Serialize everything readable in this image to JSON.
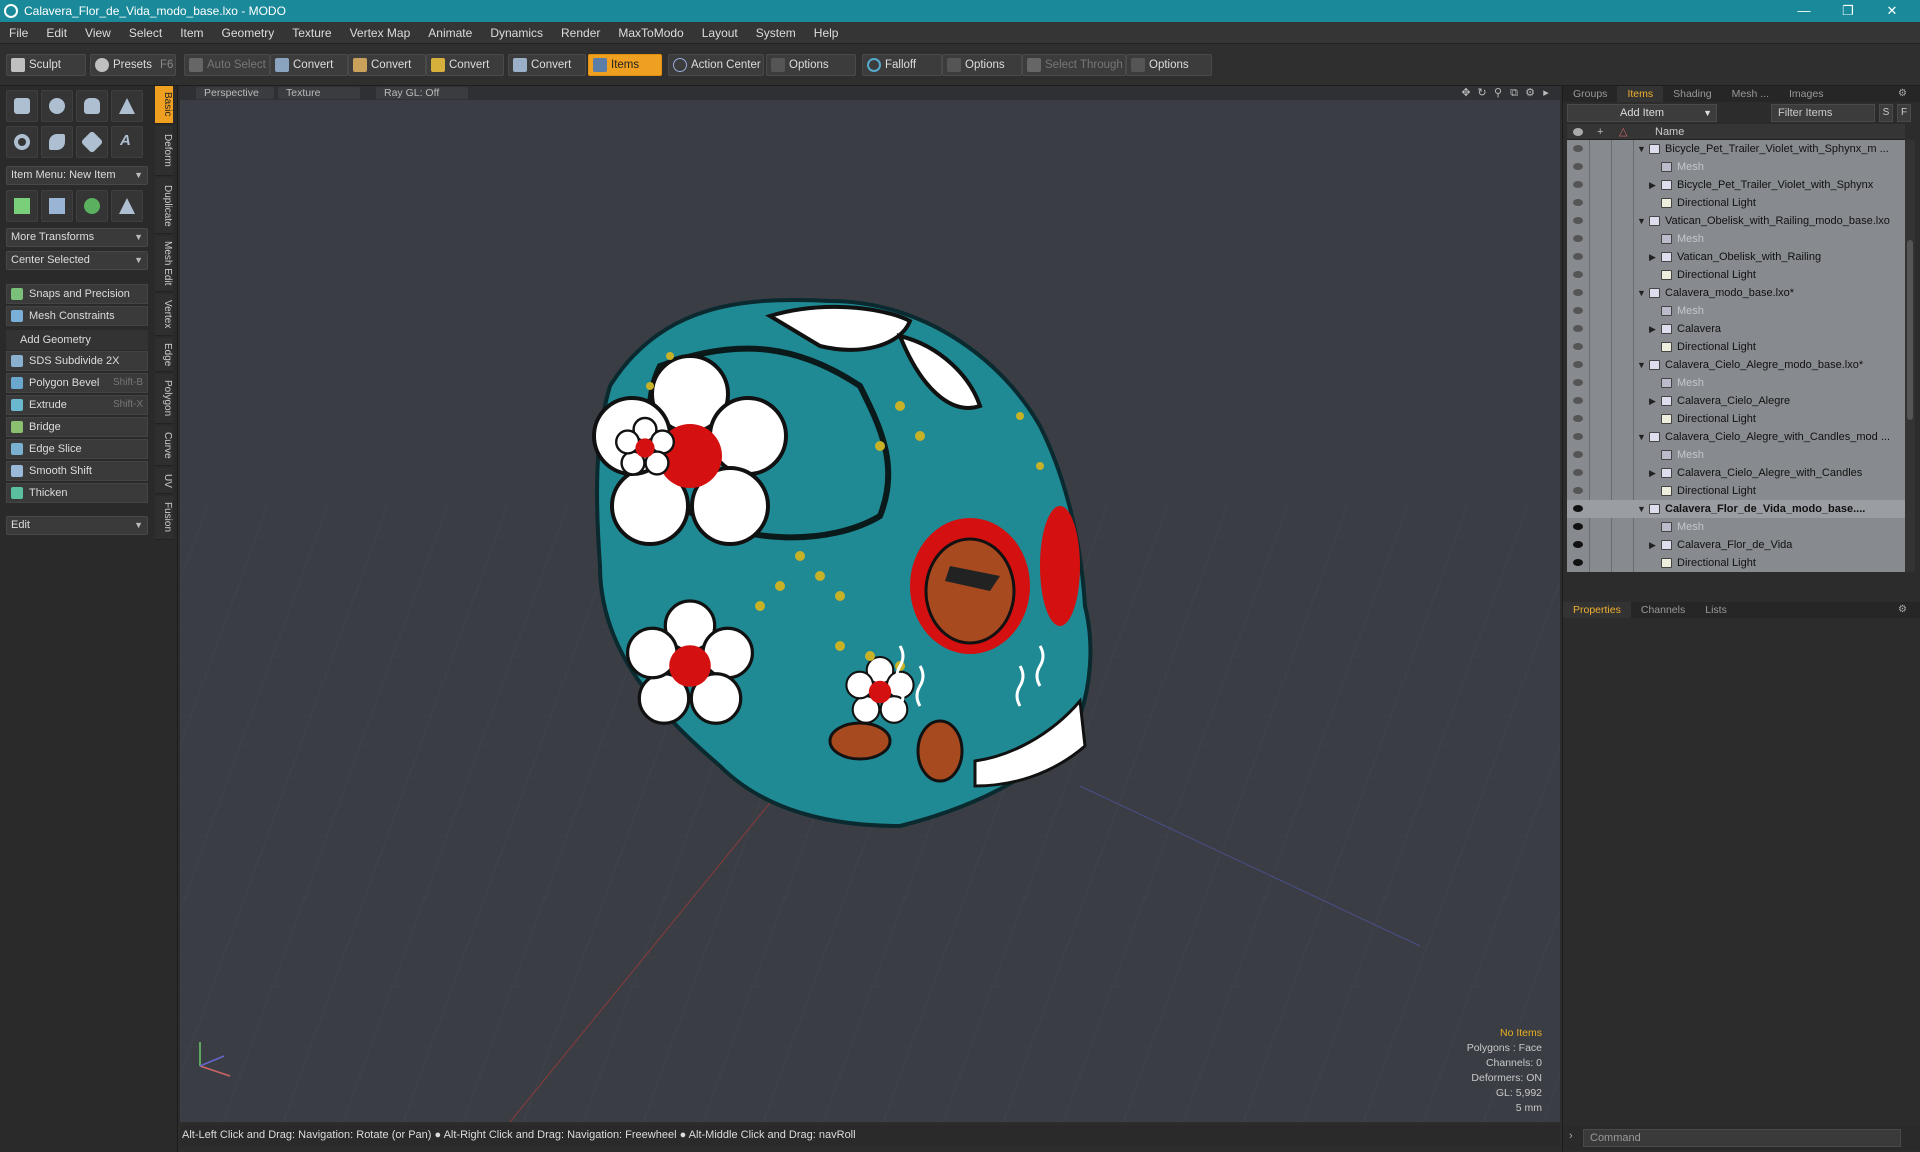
{
  "window": {
    "title": "Calavera_Flor_de_Vida_modo_base.lxo - MODO"
  },
  "menu": [
    "File",
    "Edit",
    "View",
    "Select",
    "Item",
    "Geometry",
    "Texture",
    "Vertex Map",
    "Animate",
    "Dynamics",
    "Render",
    "MaxToModo",
    "Layout",
    "System",
    "Help"
  ],
  "toolbar": {
    "sculpt": "Sculpt",
    "presets": "Presets",
    "presets_key": "F6",
    "auto_select": "Auto Select",
    "convert1": "Convert",
    "convert2": "Convert",
    "convert3": "Convert",
    "convert4": "Convert",
    "items": "Items",
    "action_center": "Action Center",
    "options1": "Options",
    "falloff": "Falloff",
    "options2": "Options",
    "select_through": "Select Through",
    "options3": "Options"
  },
  "left": {
    "item_menu": "Item Menu: New Item",
    "more_transforms": "More Transforms",
    "center_selected": "Center Selected",
    "snaps": "Snaps and Precision",
    "mesh_constraints": "Mesh Constraints",
    "add_geometry": "Add Geometry",
    "tools": [
      {
        "label": "SDS Subdivide 2X",
        "key": ""
      },
      {
        "label": "Polygon Bevel",
        "key": "Shift-B"
      },
      {
        "label": "Extrude",
        "key": "Shift-X"
      },
      {
        "label": "Bridge",
        "key": ""
      },
      {
        "label": "Edge Slice",
        "key": ""
      },
      {
        "label": "Smooth Shift",
        "key": ""
      },
      {
        "label": "Thicken",
        "key": ""
      }
    ],
    "edit": "Edit",
    "vtabs": [
      "Basic",
      "Deform",
      "Duplicate",
      "Mesh Edit",
      "Vertex",
      "Edge",
      "Polygon",
      "Curve",
      "UV",
      "Fusion"
    ]
  },
  "viewport": {
    "perspective": "Perspective",
    "texture": "Texture",
    "raygl": "Ray GL: Off",
    "hud": {
      "no_items": "No Items",
      "polygons": "Polygons : Face",
      "channels": "Channels: 0",
      "deformers": "Deformers: ON",
      "gl": "GL: 5,992",
      "unit": "5 mm"
    }
  },
  "status": "Alt-Left Click and Drag: Navigation: Rotate (or Pan) ● Alt-Right Click and Drag: Navigation: Freewheel ● Alt-Middle Click and Drag: navRoll",
  "right": {
    "tabs": [
      "Groups",
      "Items",
      "Shading",
      "Mesh ...",
      "Images"
    ],
    "add_item": "Add Item",
    "filter": "Filter Items",
    "s": "S",
    "f": "F",
    "name_col": "Name",
    "rows": [
      {
        "label": "Bicycle_Pet_Trailer_Violet_with_Sphynx_m ...",
        "level": 0,
        "type": "scene"
      },
      {
        "label": "Mesh",
        "level": 1,
        "type": "mesh"
      },
      {
        "label": "Bicycle_Pet_Trailer_Violet_with_Sphynx",
        "level": 1,
        "type": "item"
      },
      {
        "label": "Directional Light",
        "level": 1,
        "type": "light"
      },
      {
        "label": "Vatican_Obelisk_with_Railing_modo_base.lxo",
        "level": 0,
        "type": "scene"
      },
      {
        "label": "Mesh",
        "level": 1,
        "type": "mesh"
      },
      {
        "label": "Vatican_Obelisk_with_Railing",
        "level": 1,
        "type": "item"
      },
      {
        "label": "Directional Light",
        "level": 1,
        "type": "light"
      },
      {
        "label": "Calavera_modo_base.lxo*",
        "level": 0,
        "type": "scene"
      },
      {
        "label": "Mesh",
        "level": 1,
        "type": "mesh"
      },
      {
        "label": "Calavera",
        "level": 1,
        "type": "item"
      },
      {
        "label": "Directional Light",
        "level": 1,
        "type": "light"
      },
      {
        "label": "Calavera_Cielo_Alegre_modo_base.lxo*",
        "level": 0,
        "type": "scene"
      },
      {
        "label": "Mesh",
        "level": 1,
        "type": "mesh"
      },
      {
        "label": "Calavera_Cielo_Alegre",
        "level": 1,
        "type": "item"
      },
      {
        "label": "Directional Light",
        "level": 1,
        "type": "light"
      },
      {
        "label": "Calavera_Cielo_Alegre_with_Candles_mod ...",
        "level": 0,
        "type": "scene"
      },
      {
        "label": "Mesh",
        "level": 1,
        "type": "mesh"
      },
      {
        "label": "Calavera_Cielo_Alegre_with_Candles",
        "level": 1,
        "type": "item"
      },
      {
        "label": "Directional Light",
        "level": 1,
        "type": "light"
      },
      {
        "label": "Calavera_Flor_de_Vida_modo_base....",
        "level": 0,
        "type": "scene",
        "bold": true
      },
      {
        "label": "Mesh",
        "level": 1,
        "type": "mesh"
      },
      {
        "label": "Calavera_Flor_de_Vida",
        "level": 1,
        "type": "item"
      },
      {
        "label": "Directional Light",
        "level": 1,
        "type": "light"
      }
    ],
    "prop_tabs": [
      "Properties",
      "Channels",
      "Lists"
    ],
    "command": "Command"
  }
}
